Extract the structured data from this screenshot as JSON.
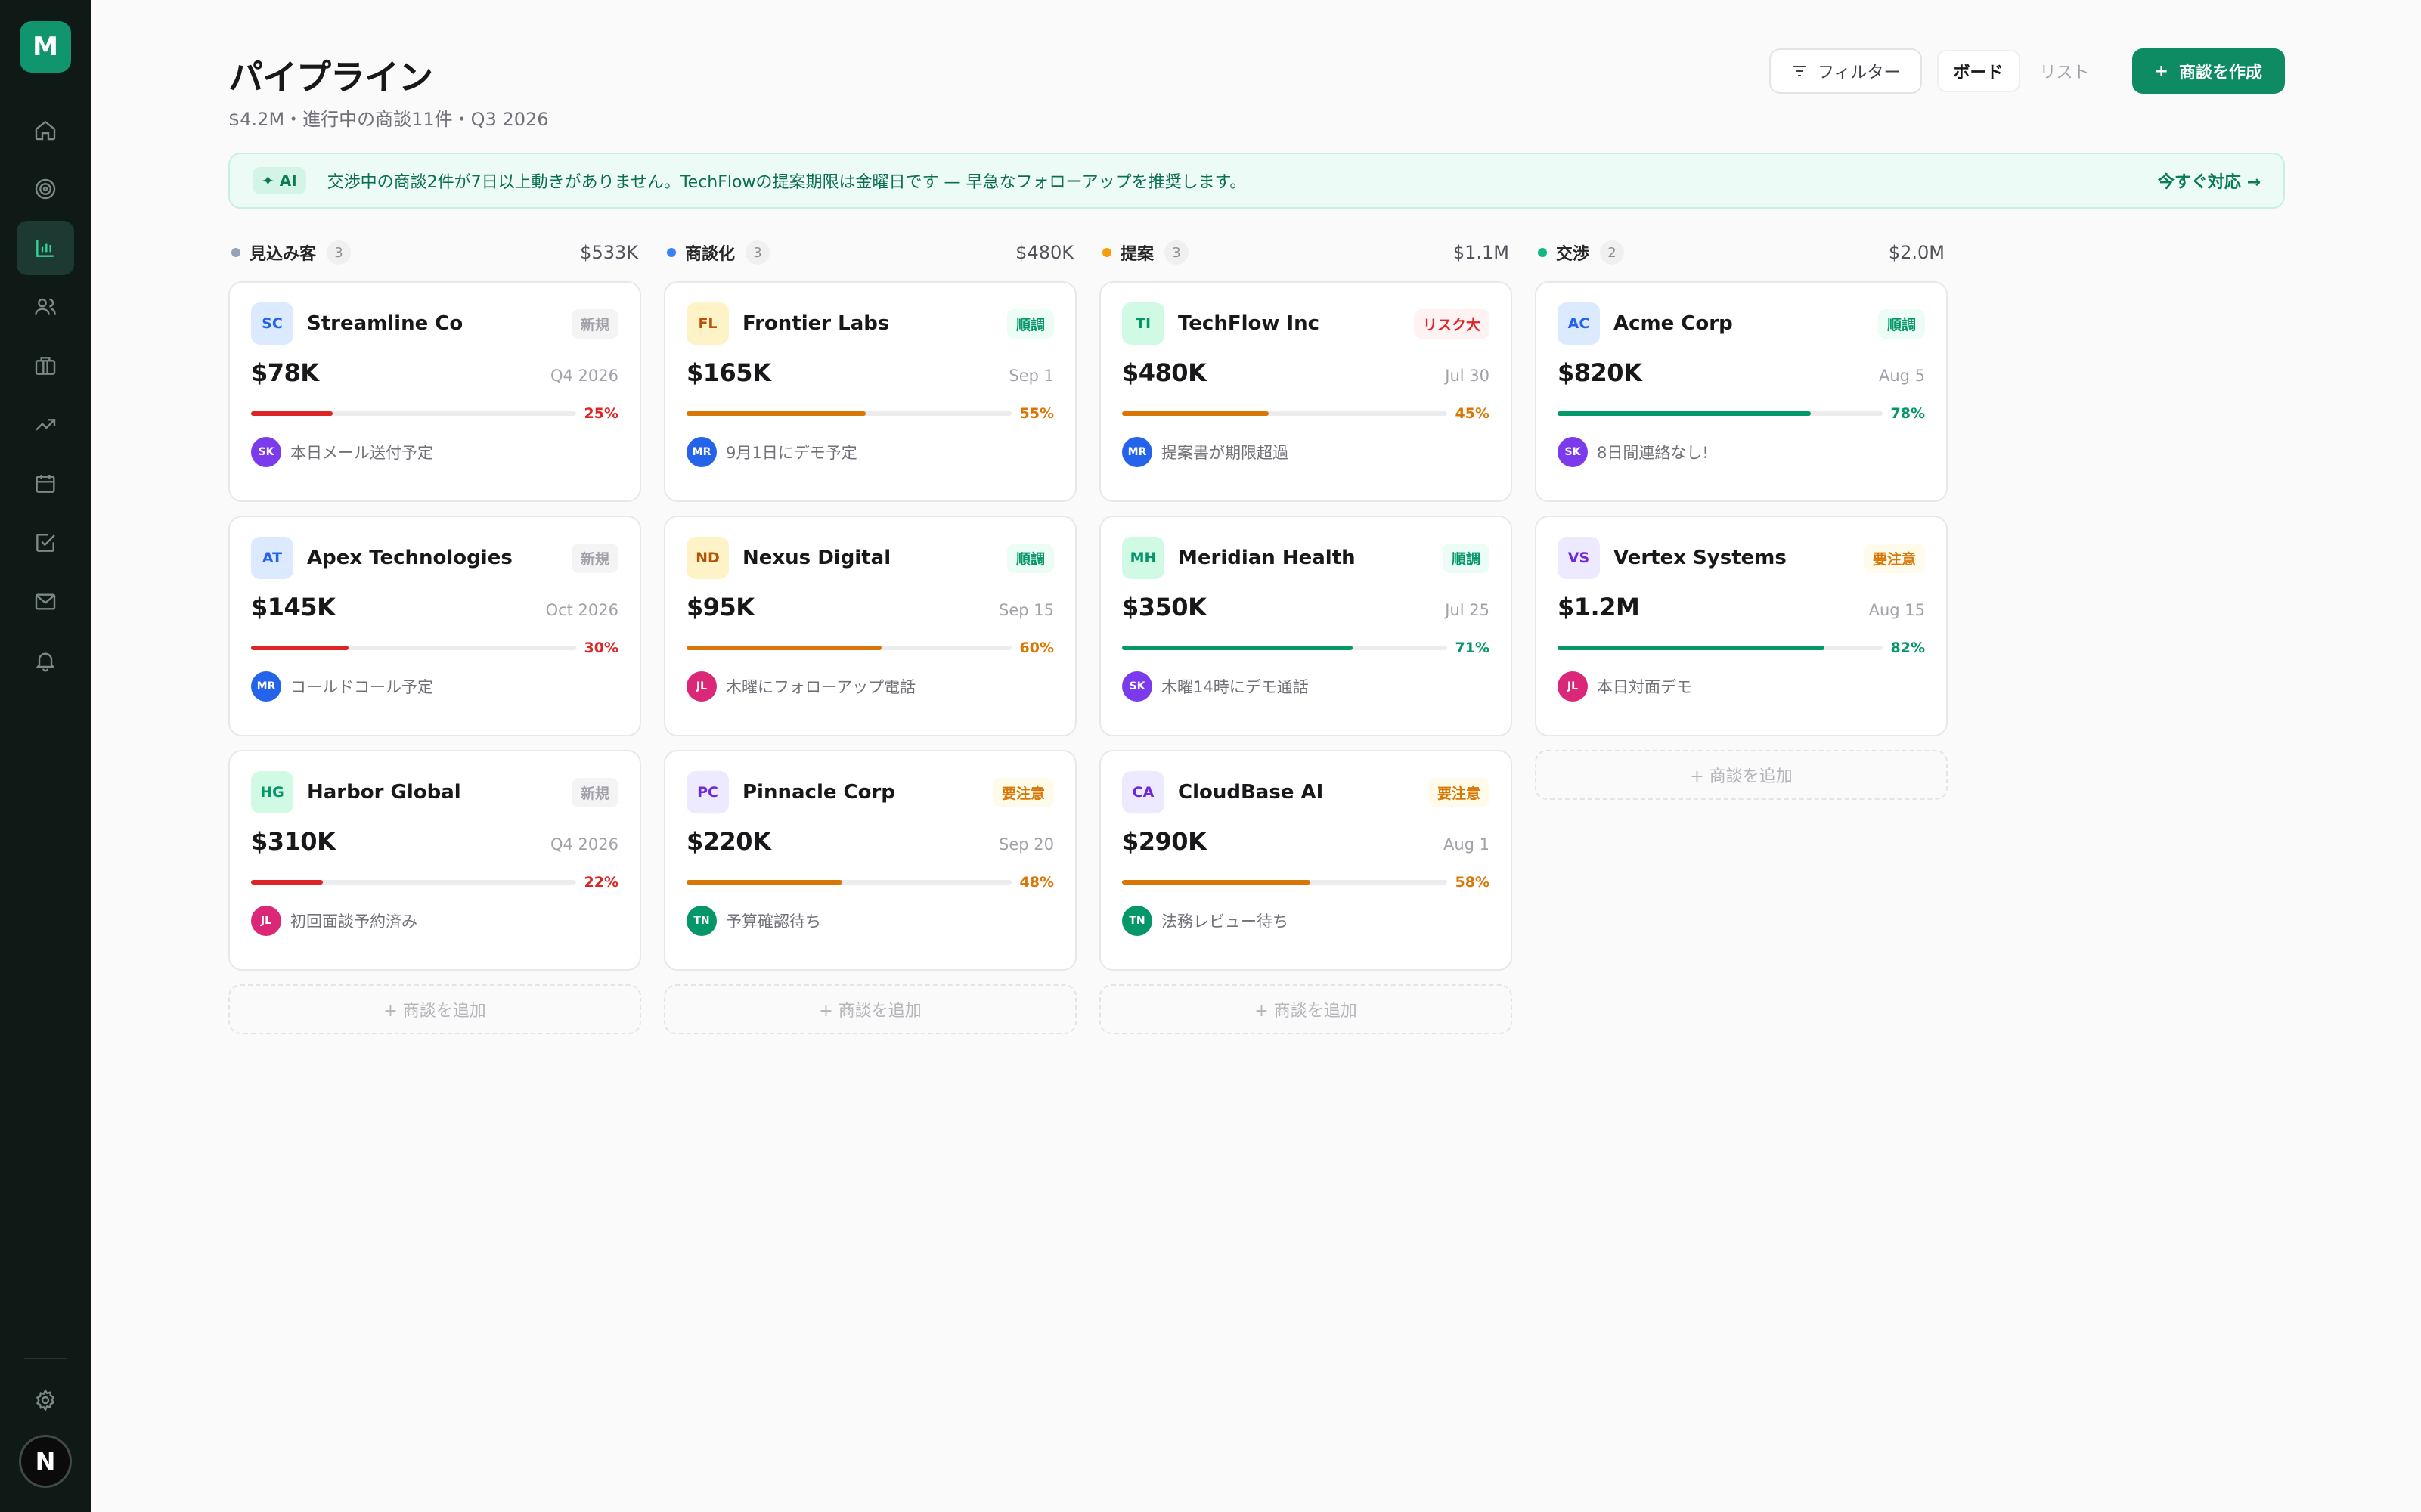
{
  "logo": "M",
  "header": {
    "title": "パイプライン",
    "subtitle": "$4.2M・進行中の商談11件・Q3 2026",
    "filter_label": "フィルター",
    "view_board": "ボード",
    "view_list": "リスト",
    "create_label": "商談を作成"
  },
  "banner": {
    "badge": "✦ AI",
    "text": "交渉中の商談2件が7日以上動きがありません。TechFlowの提案期限は金曜日です — 早急なフォローアップを推奨します。",
    "action": "今すぐ対応 →"
  },
  "add_label": "+ 商談を追加",
  "user_initial": "N",
  "columns": [
    {
      "name": "見込み客",
      "count": "3",
      "total": "$533K",
      "cards": [
        {
          "initials": "SC",
          "company": "Streamline Co",
          "status": "新規",
          "amount": "$78K",
          "date": "Q4 2026",
          "progress": 25,
          "pct": "25%",
          "owner": "SK",
          "note": "本日メール送付予定"
        },
        {
          "initials": "AT",
          "company": "Apex Technologies",
          "status": "新規",
          "amount": "$145K",
          "date": "Oct 2026",
          "progress": 30,
          "pct": "30%",
          "owner": "MR",
          "note": "コールドコール予定"
        },
        {
          "initials": "HG",
          "company": "Harbor Global",
          "status": "新規",
          "amount": "$310K",
          "date": "Q4 2026",
          "progress": 22,
          "pct": "22%",
          "owner": "JL",
          "note": "初回面談予約済み"
        }
      ]
    },
    {
      "name": "商談化",
      "count": "3",
      "total": "$480K",
      "cards": [
        {
          "initials": "FL",
          "company": "Frontier Labs",
          "status": "順調",
          "amount": "$165K",
          "date": "Sep 1",
          "progress": 55,
          "pct": "55%",
          "owner": "MR",
          "note": "9月1日にデモ予定"
        },
        {
          "initials": "ND",
          "company": "Nexus Digital",
          "status": "順調",
          "amount": "$95K",
          "date": "Sep 15",
          "progress": 60,
          "pct": "60%",
          "owner": "JL",
          "note": "木曜にフォローアップ電話"
        },
        {
          "initials": "PC",
          "company": "Pinnacle Corp",
          "status": "要注意",
          "amount": "$220K",
          "date": "Sep 20",
          "progress": 48,
          "pct": "48%",
          "owner": "TN",
          "note": "予算確認待ち"
        }
      ]
    },
    {
      "name": "提案",
      "count": "3",
      "total": "$1.1M",
      "cards": [
        {
          "initials": "TI",
          "company": "TechFlow Inc",
          "status": "リスク大",
          "amount": "$480K",
          "date": "Jul 30",
          "progress": 45,
          "pct": "45%",
          "owner": "MR",
          "note": "提案書が期限超過"
        },
        {
          "initials": "MH",
          "company": "Meridian Health",
          "status": "順調",
          "amount": "$350K",
          "date": "Jul 25",
          "progress": 71,
          "pct": "71%",
          "owner": "SK",
          "note": "木曜14時にデモ通話"
        },
        {
          "initials": "CA",
          "company": "CloudBase AI",
          "status": "要注意",
          "amount": "$290K",
          "date": "Aug 1",
          "progress": 58,
          "pct": "58%",
          "owner": "TN",
          "note": "法務レビュー待ち"
        }
      ]
    },
    {
      "name": "交渉",
      "count": "2",
      "total": "$2.0M",
      "cards": [
        {
          "initials": "AC",
          "company": "Acme Corp",
          "status": "順調",
          "amount": "$820K",
          "date": "Aug 5",
          "progress": 78,
          "pct": "78%",
          "owner": "SK",
          "note": "8日間連絡なし!"
        },
        {
          "initials": "VS",
          "company": "Vertex Systems",
          "status": "要注意",
          "amount": "$1.2M",
          "date": "Aug 15",
          "progress": 82,
          "pct": "82%",
          "owner": "JL",
          "note": "本日対面デモ"
        }
      ]
    }
  ]
}
